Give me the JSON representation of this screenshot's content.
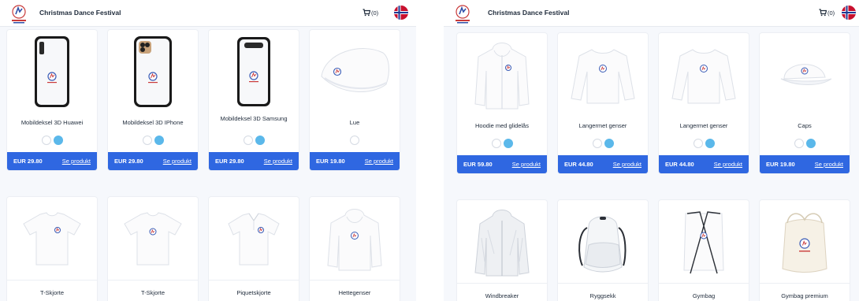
{
  "header": {
    "title": "Christmas Dance Festival",
    "cart_count": "(0)",
    "logo_icon": "festival-logo-icon",
    "cart_icon": "shopping-cart-icon",
    "flag_icon": "norway-flag-icon"
  },
  "colors": {
    "accent": "#2f67e1",
    "swatch_blue": "#5bb8ea",
    "background": "#f6f8fc"
  },
  "left": {
    "products_row1": [
      {
        "name": "Mobildeksel 3D Huawei",
        "price": "EUR 29.80",
        "link": "Se produkt",
        "image": "phone-case-huawei-icon",
        "swatches": [
          "white",
          "blue"
        ]
      },
      {
        "name": "Mobildeksel 3D IPhone",
        "price": "EUR 29.80",
        "link": "Se produkt",
        "image": "phone-case-iphone-icon",
        "swatches": [
          "white",
          "blue"
        ]
      },
      {
        "name": "Mobildeksel 3D Samsung",
        "price": "EUR 29.80",
        "link": "Se produkt",
        "image": "phone-case-samsung-icon",
        "swatches": [
          "white",
          "blue"
        ]
      },
      {
        "name": "Lue",
        "price": "EUR 19.80",
        "link": "Se produkt",
        "image": "beanie-icon",
        "swatches": [
          "white"
        ]
      }
    ],
    "products_row2": [
      {
        "name": "T-Skjorte",
        "image": "tshirt-icon"
      },
      {
        "name": "T-Skjorte",
        "image": "tshirt-icon"
      },
      {
        "name": "Piquetskjorte",
        "image": "polo-shirt-icon"
      },
      {
        "name": "Hettegenser",
        "image": "hoodie-icon"
      }
    ]
  },
  "right": {
    "products_row1": [
      {
        "name": "Hoodie med glidelås",
        "price": "EUR 59.80",
        "link": "Se produkt",
        "image": "zip-hoodie-icon",
        "swatches": [
          "white",
          "blue"
        ]
      },
      {
        "name": "Langermet genser",
        "price": "EUR 44.80",
        "link": "Se produkt",
        "image": "sweater-icon",
        "swatches": [
          "white",
          "blue"
        ]
      },
      {
        "name": "Langermet genser",
        "price": "EUR 44.80",
        "link": "Se produkt",
        "image": "sweater-icon",
        "swatches": [
          "white",
          "blue"
        ]
      },
      {
        "name": "Caps",
        "price": "EUR 19.80",
        "link": "Se produkt",
        "image": "cap-icon",
        "swatches": [
          "white",
          "blue"
        ]
      }
    ],
    "products_row2": [
      {
        "name": "Windbreaker",
        "image": "windbreaker-icon"
      },
      {
        "name": "Ryggsekk",
        "image": "backpack-icon"
      },
      {
        "name": "Gymbag",
        "image": "gymbag-icon"
      },
      {
        "name": "Gymbag premium",
        "image": "gymbag-premium-icon"
      }
    ]
  }
}
